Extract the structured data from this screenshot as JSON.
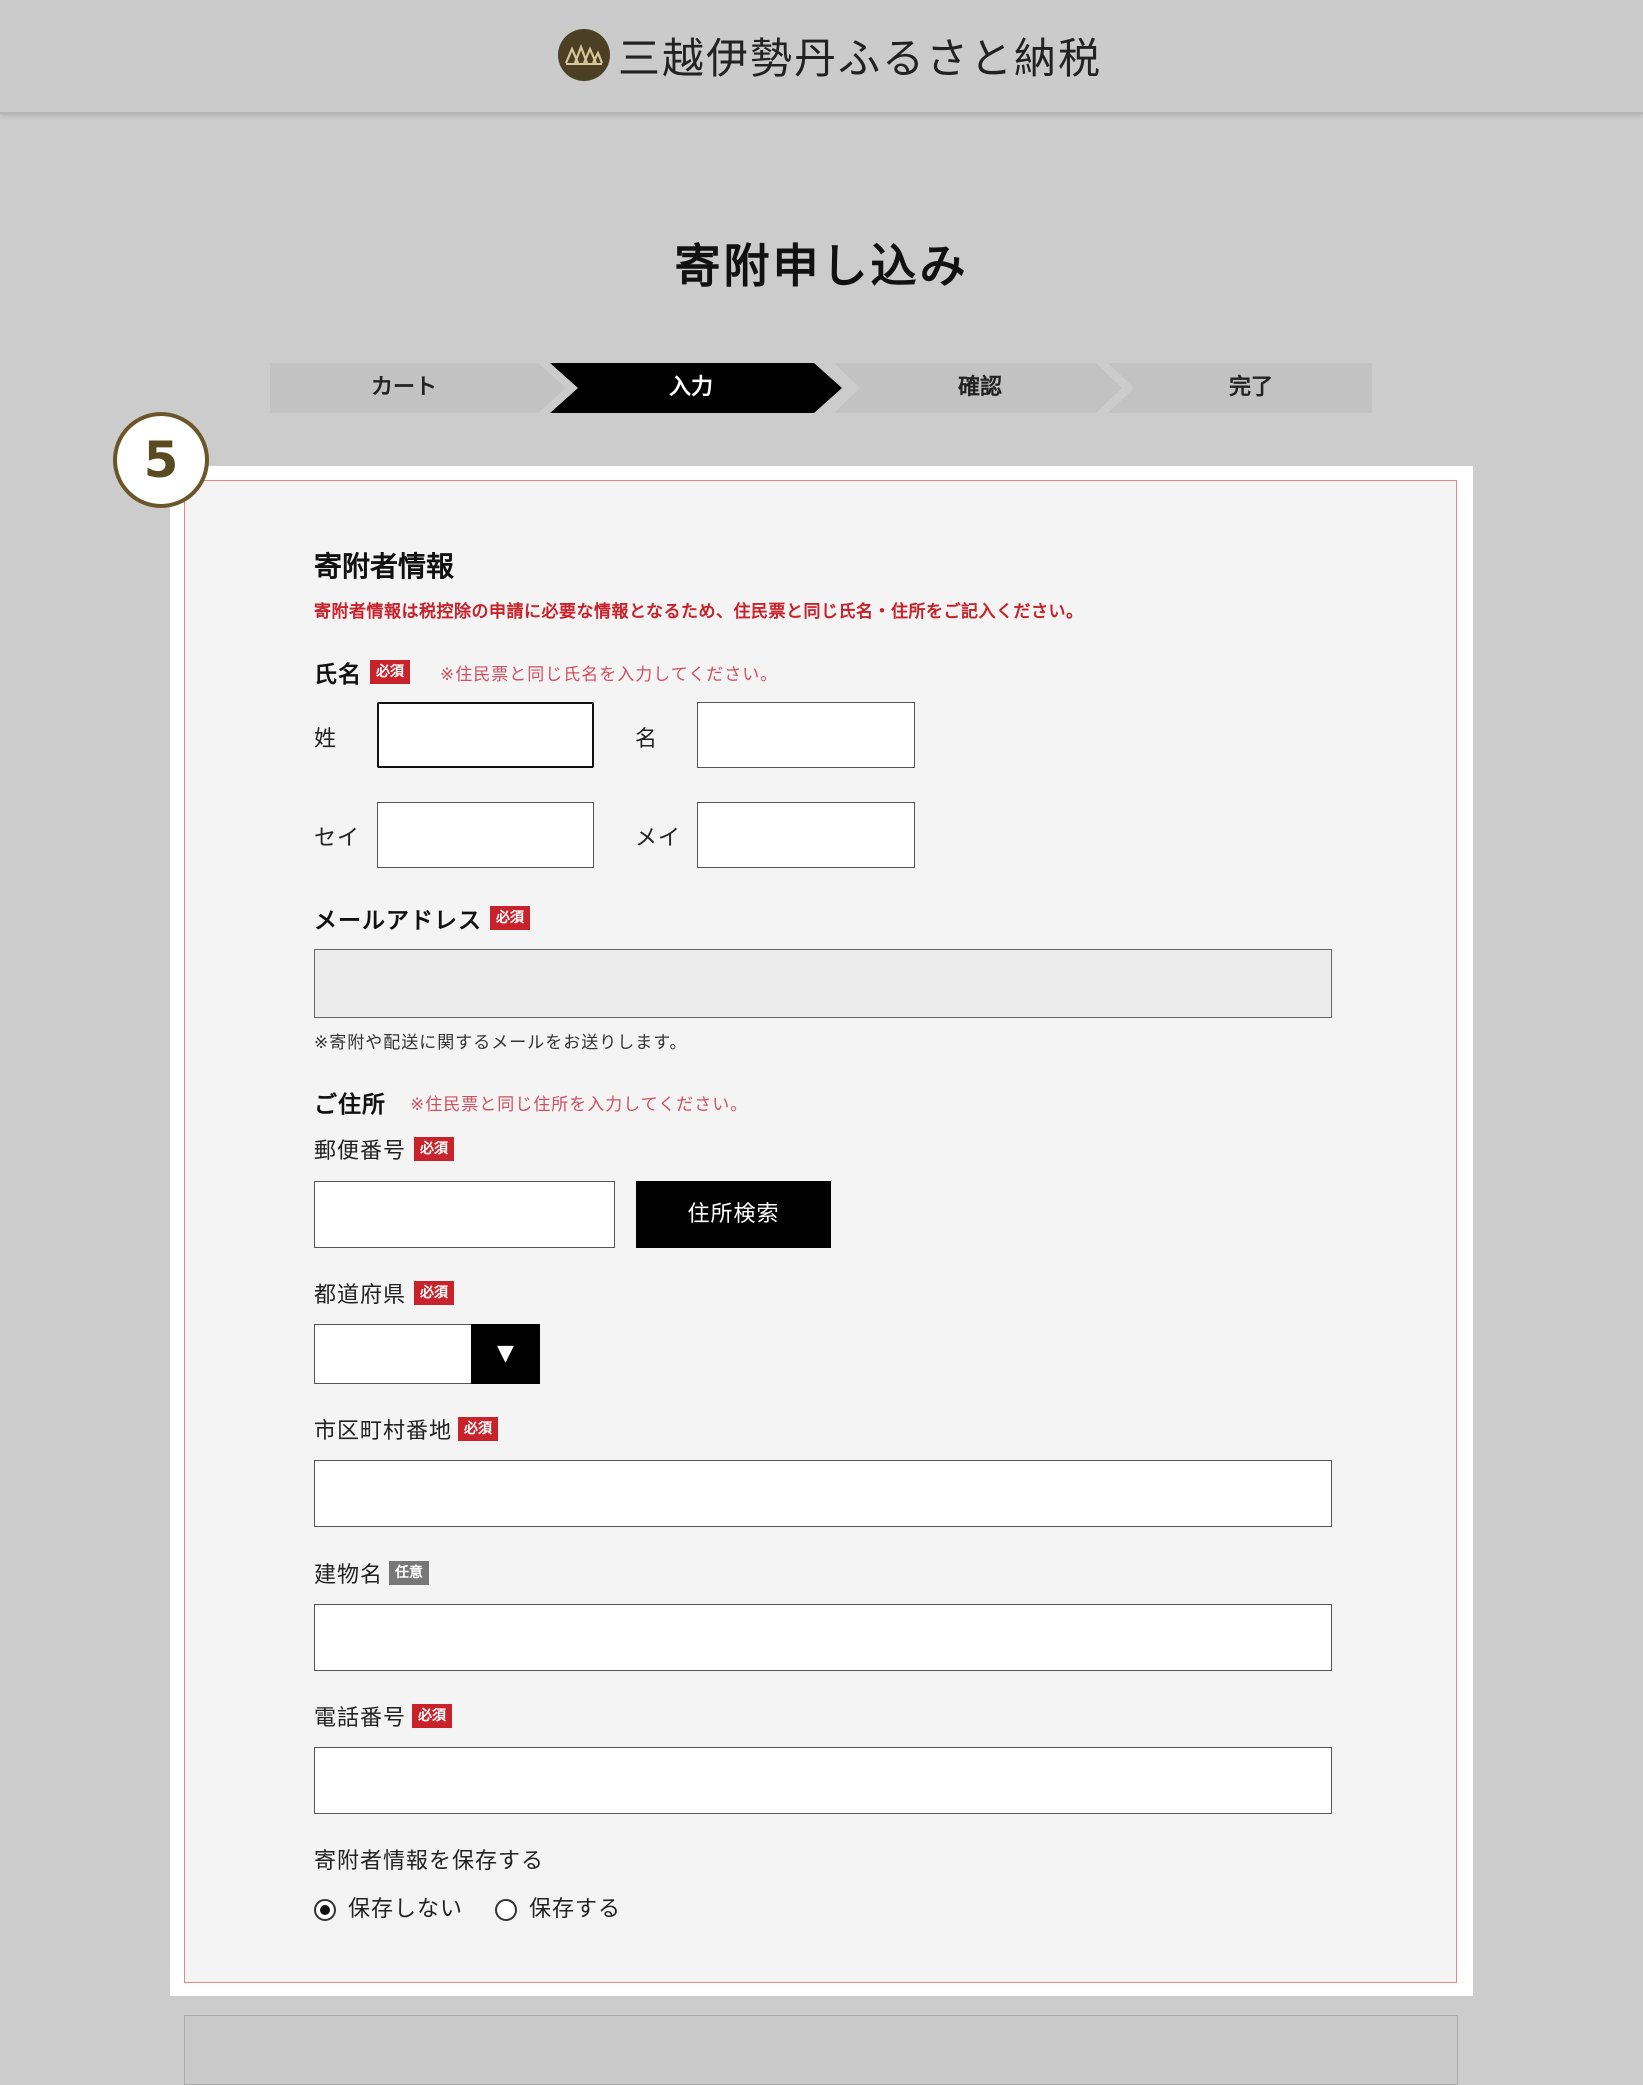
{
  "header": {
    "logo_icon": "mountain-logo-icon",
    "brand_name": "三越伊勢丹ふるさと納税"
  },
  "page_title": "寄附申し込み",
  "steps": [
    {
      "label": "カート",
      "active": false
    },
    {
      "label": "入力",
      "active": true
    },
    {
      "label": "確認",
      "active": false
    },
    {
      "label": "完了",
      "active": false
    }
  ],
  "annotation_badge": "5",
  "form": {
    "section_title": "寄附者情報",
    "section_warning": "寄附者情報は税控除の申請に必要な情報となるため、住民票と同じ氏名・住所をご記入ください。",
    "required_label": "必須",
    "optional_label": "任意",
    "name": {
      "label": "氏名",
      "note": "※住民票と同じ氏名を入力してください。",
      "sei_label": "姓",
      "mei_label": "名",
      "sei_kana_label": "セイ",
      "mei_kana_label": "メイ",
      "sei_value": "",
      "mei_value": "",
      "sei_kana_value": "",
      "mei_kana_value": ""
    },
    "email": {
      "label": "メールアドレス",
      "value": "",
      "note": "※寄附や配送に関するメールをお送りします。"
    },
    "address": {
      "label": "ご住所",
      "note": "※住民票と同じ住所を入力してください。",
      "postal_label": "郵便番号",
      "postal_value": "",
      "search_button": "住所検索",
      "prefecture_label": "都道府県",
      "prefecture_value": "",
      "prefecture_arrow": "▼",
      "city_label": "市区町村番地",
      "city_value": "",
      "building_label": "建物名",
      "building_value": ""
    },
    "phone": {
      "label": "電話番号",
      "value": ""
    },
    "save": {
      "label": "寄附者情報を保存する",
      "options": [
        {
          "label": "保存しない",
          "selected": true
        },
        {
          "label": "保存する",
          "selected": false
        }
      ]
    }
  },
  "colors": {
    "background": "#cccccc",
    "required_red": "#c8222a",
    "brand_gold": "#4b3f24",
    "active_step": "#000000"
  }
}
